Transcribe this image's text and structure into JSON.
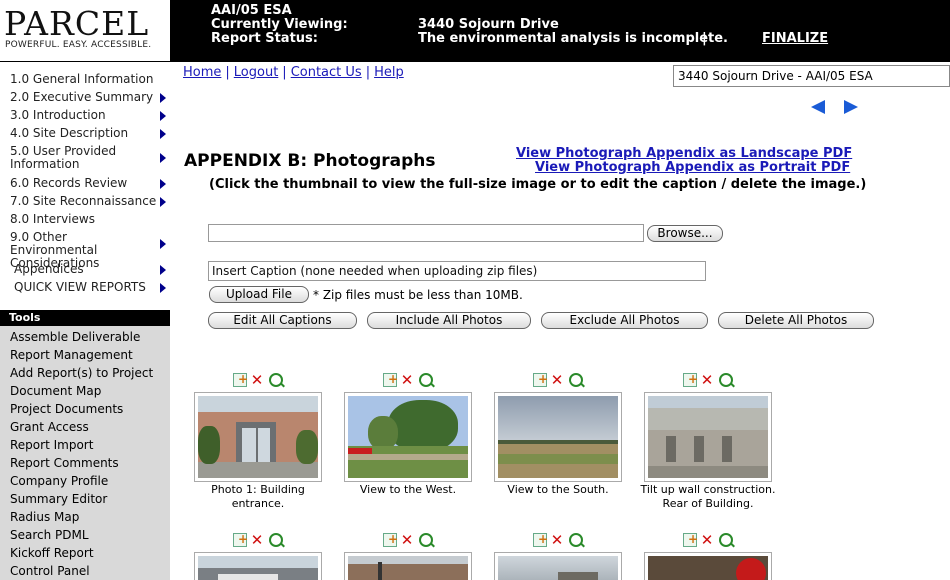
{
  "logo": {
    "word": "PARCEL",
    "tagline": "POWERFUL. EASY. ACCESSIBLE."
  },
  "header": {
    "report_type": "AAI/05 ESA",
    "viewing_label": "Currently Viewing:",
    "viewing_value": "3440 Sojourn Drive",
    "status_label": "Report Status:",
    "status_value": "The environmental analysis is incomplete.",
    "separator": "|",
    "finalize": "FINALIZE"
  },
  "nav": {
    "items": [
      {
        "label": "1.0 General Information",
        "arrow": false
      },
      {
        "label": "2.0 Executive Summary",
        "arrow": true
      },
      {
        "label": "3.0 Introduction",
        "arrow": true
      },
      {
        "label": "4.0 Site Description",
        "arrow": true
      },
      {
        "label": "5.0 User Provided Information",
        "arrow": true
      },
      {
        "label": "6.0 Records Review",
        "arrow": true
      },
      {
        "label": "7.0 Site Reconnaissance",
        "arrow": true
      },
      {
        "label": "8.0 Interviews",
        "arrow": false
      },
      {
        "label": "9.0 Other Environmental Considerations",
        "arrow": true
      },
      {
        "label": "Appendices",
        "arrow": true
      },
      {
        "label": "QUICK VIEW REPORTS",
        "arrow": true
      }
    ]
  },
  "tools": {
    "header": "Tools",
    "items": [
      "Assemble Deliverable",
      "Report Management",
      "Add Report(s) to Project",
      "Document Map",
      "Project Documents",
      "Grant Access",
      "Report Import",
      "Report Comments",
      "Company Profile",
      "Summary Editor",
      "Radius Map",
      "Search PDML",
      "Kickoff Report",
      "Control Panel"
    ]
  },
  "toplinks": {
    "home": "Home",
    "logout": "Logout",
    "contact": "Contact Us",
    "help": "Help",
    "sep": "|"
  },
  "report_select": {
    "value": "3440 Sojourn Drive - AAI/05 ESA"
  },
  "icons": {
    "prev": "left-arrow-icon",
    "next": "right-arrow-icon",
    "colors": {
      "arrow": "#1a5bd6",
      "link": "#1a1ab8"
    }
  },
  "main": {
    "title": "APPENDIX B: Photographs",
    "pdf_landscape": "View Photograph Appendix as Landscape PDF",
    "pdf_portrait": "View Photograph Appendix as Portrait PDF",
    "instructions": "(Click the thumbnail to view the full-size image or to edit the caption / delete the image.)",
    "browse": "Browse...",
    "caption_placeholder": "Insert Caption (none needed when uploading zip files)",
    "upload": "Upload File",
    "zip_note": "* Zip files must be less than 10MB.",
    "edit_captions": "Edit All Captions",
    "include_all": "Include All Photos",
    "exclude_all": "Exclude All Photos",
    "delete_all": "Delete All Photos"
  },
  "photos": [
    {
      "caption_1": "Photo 1: Building",
      "caption_2": "entrance."
    },
    {
      "caption_1": "View to the West.",
      "caption_2": ""
    },
    {
      "caption_1": "View to the South.",
      "caption_2": ""
    },
    {
      "caption_1": "Tilt up wall construction.",
      "caption_2": "Rear of Building."
    }
  ]
}
